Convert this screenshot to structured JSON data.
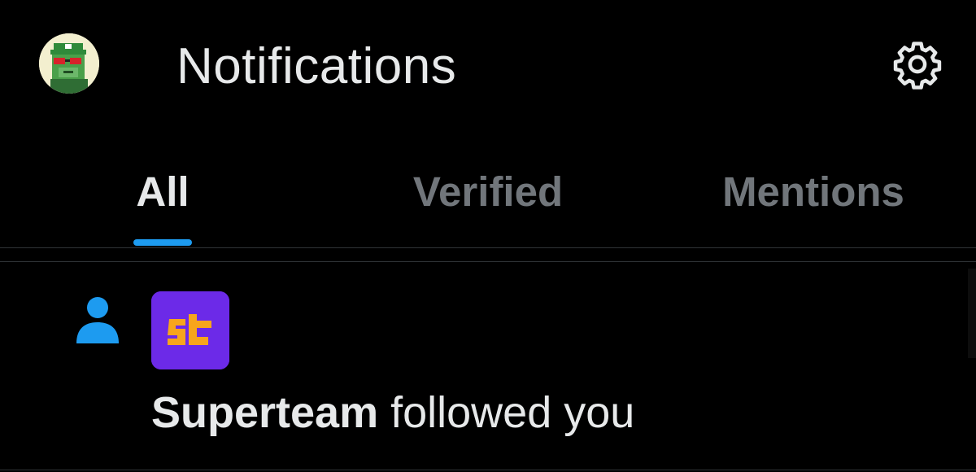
{
  "header": {
    "title": "Notifications",
    "avatar_icon": "pixel-art-ape-avatar",
    "settings_icon": "gear-icon"
  },
  "tabs": [
    {
      "label": "All",
      "active": true
    },
    {
      "label": "Verified",
      "active": false
    },
    {
      "label": "Mentions",
      "active": false
    }
  ],
  "notifications": [
    {
      "type_icon": "person-icon",
      "avatar_icon": "superteam-logo",
      "user": "Superteam",
      "action": " followed you"
    }
  ],
  "colors": {
    "background": "#000000",
    "text_primary": "#e7e9ea",
    "text_secondary": "#71767b",
    "accent": "#1d9bf0",
    "divider": "#2f3336",
    "superteam_bg": "#6c2ae8",
    "superteam_logo": "#f7a51c"
  }
}
